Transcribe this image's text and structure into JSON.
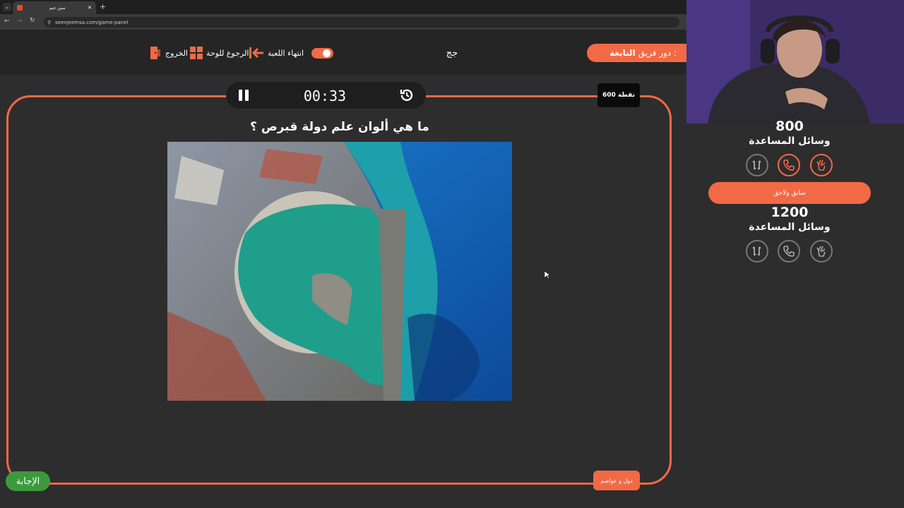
{
  "browser": {
    "tab_title": "سين جيم",
    "url": "seenjeemsa.com/game-panel",
    "new_tab": "+"
  },
  "header": {
    "exit_label": "الخروج",
    "back_label": "الرجوع للوحة",
    "end_game_label": "انتهاء اللعبة",
    "team_name": "جج",
    "turn_label": "دور فريق :",
    "turn_team": "النابغة"
  },
  "game": {
    "timer": "00:33",
    "points": "600 نقطة",
    "question": "ما هي ألوان علم دولة قبرص ؟",
    "category": "دول و عواصم",
    "answer_label": "الإجابة"
  },
  "teams": [
    {
      "score": "800",
      "aids_title": "وسائل المساعدة"
    },
    {
      "score": "1200",
      "aids_title": "وسائل المساعدة"
    }
  ],
  "switch_button": "سابق ولاحق",
  "colors": {
    "accent": "#f26a45",
    "background": "#2d2d2d",
    "answer": "#3c9a3c"
  }
}
